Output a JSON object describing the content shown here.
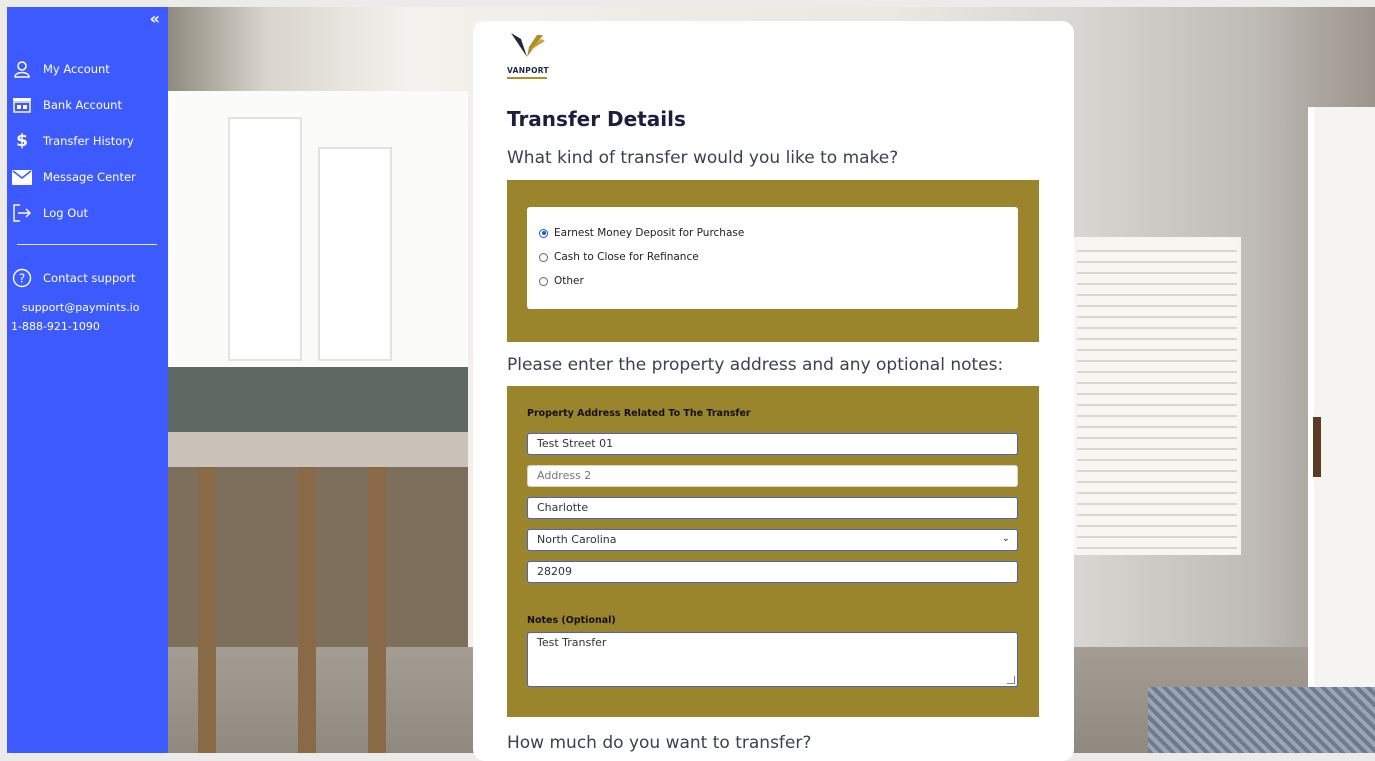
{
  "sidebar": {
    "collapse_icon": "«",
    "items": [
      {
        "label": "My Account",
        "icon": "user-icon"
      },
      {
        "label": "Bank Account",
        "icon": "bank-icon"
      },
      {
        "label": "Transfer History",
        "icon": "dollar-icon"
      },
      {
        "label": "Message Center",
        "icon": "mail-icon"
      },
      {
        "label": "Log Out",
        "icon": "logout-icon"
      }
    ],
    "support": {
      "label": "Contact support",
      "email": "support@paymints.io",
      "phone": "1-888-921-1090"
    },
    "accent_color": "#3d5afe"
  },
  "card": {
    "logo_text": "VANPORT",
    "title": "Transfer Details",
    "transfer_question": "What kind of transfer would you like to make?",
    "transfer_options": [
      {
        "label": "Earnest Money Deposit for Purchase",
        "selected": true
      },
      {
        "label": "Cash to Close for Refinance",
        "selected": false
      },
      {
        "label": "Other",
        "selected": false
      }
    ],
    "address_question": "Please enter the property address and any optional notes:",
    "address_label": "Property Address Related To The Transfer",
    "address_line1": "Test Street 01",
    "address_line2_placeholder": "Address 2",
    "city": "Charlotte",
    "state": "North Carolina",
    "zip": "28209",
    "notes_label": "Notes (Optional)",
    "notes_value": "Test Transfer",
    "amount_question": "How much do you want to transfer?",
    "panel_color": "#9a852c"
  }
}
